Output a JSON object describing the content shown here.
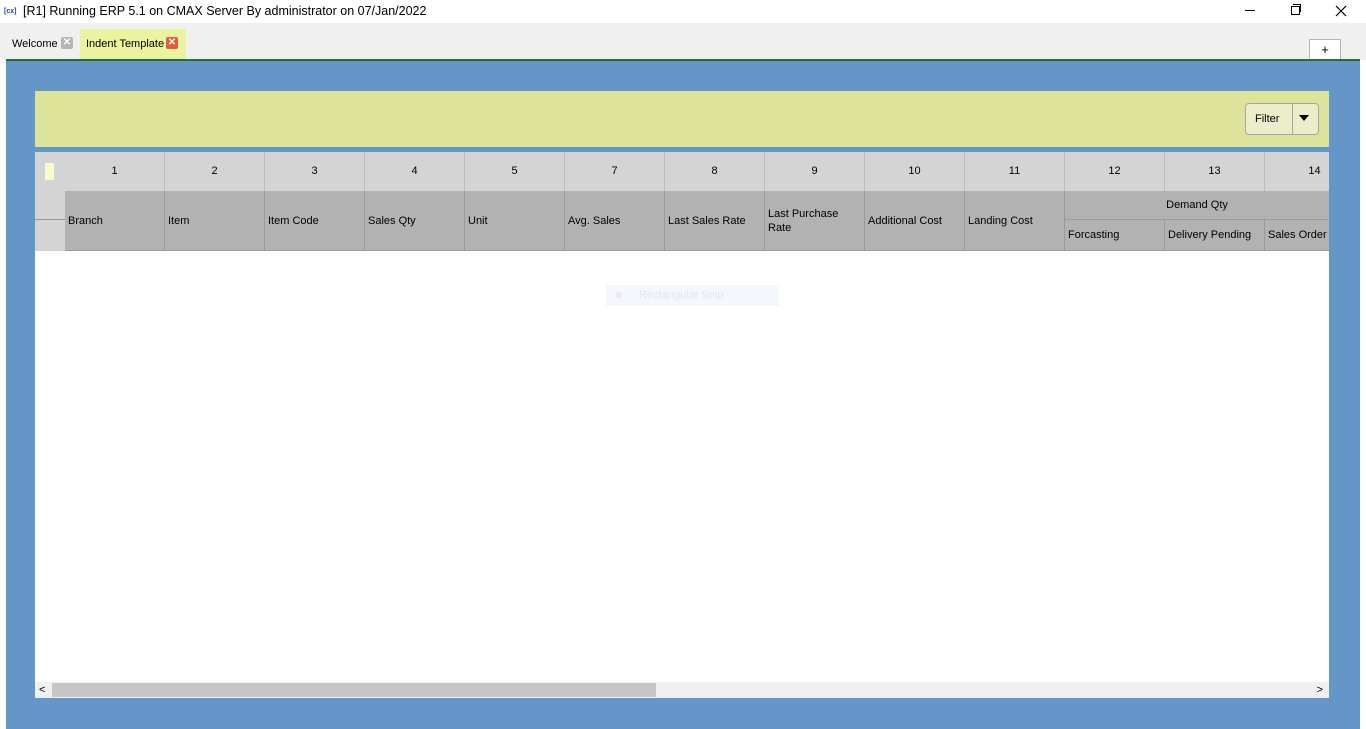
{
  "window": {
    "title": "[R1] Running ERP 5.1 on CMAX Server By administrator on 07/Jan/2022",
    "app_icon_label": "[cx]",
    "minimize_icon": "minimize-icon",
    "maximize_icon": "restore-icon",
    "close_icon": "close-icon"
  },
  "tabs": [
    {
      "label": "Welcome",
      "active": false
    },
    {
      "label": "Indent Template",
      "active": true
    }
  ],
  "add_tab_label": "+",
  "filter": {
    "label": "Filter"
  },
  "grid": {
    "column_numbers": [
      "1",
      "2",
      "3",
      "4",
      "5",
      "7",
      "8",
      "9",
      "10",
      "11",
      "12",
      "13",
      "14"
    ],
    "columns": [
      "Branch",
      "Item",
      "Item Code",
      "Sales Qty",
      "Unit",
      "Avg. Sales",
      "Last Sales Rate",
      "Last Purchase Rate",
      "Additional Cost",
      "Landing Cost"
    ],
    "group": {
      "label": "Demand Qty",
      "subcolumns": [
        "Forcasting",
        "Delivery Pending",
        "Sales Order"
      ]
    },
    "rows": []
  },
  "overlay": {
    "label": "Rectangular Snip"
  },
  "scrollbar": {
    "left_arrow": "<",
    "right_arrow": ">"
  },
  "colors": {
    "frame": "#6496c8",
    "filter_panel": "#dde39b",
    "active_tab": "#e9f3a0",
    "tab_close_active": "#e25b3a"
  }
}
